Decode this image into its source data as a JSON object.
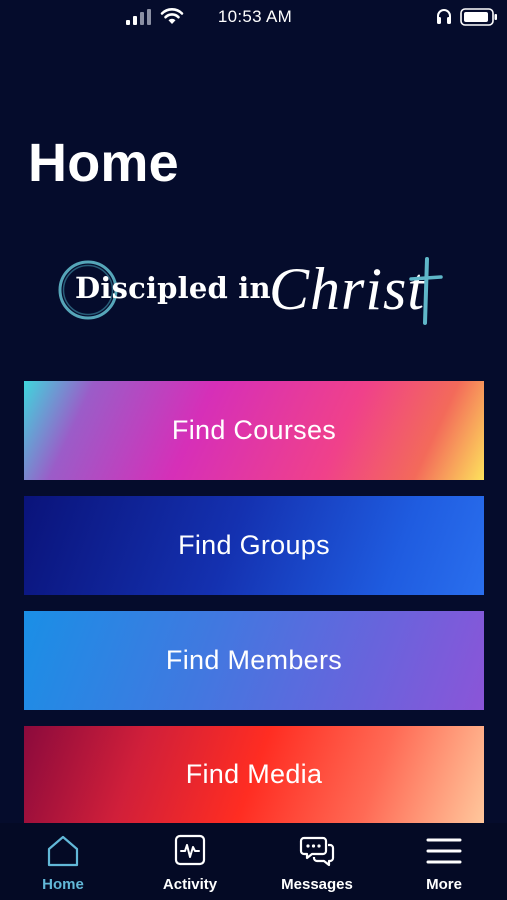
{
  "status_bar": {
    "time": "10:53 AM",
    "icons": [
      "signal-icon",
      "wifi-icon",
      "headphones-icon",
      "battery-icon"
    ]
  },
  "page": {
    "title": "Home"
  },
  "logo": {
    "word1": "Discipled in",
    "word2": "Christ"
  },
  "actions": [
    {
      "label": "Find Courses"
    },
    {
      "label": "Find Groups"
    },
    {
      "label": "Find Members"
    },
    {
      "label": "Find Media"
    }
  ],
  "tab_bar": {
    "active_tab": "Home",
    "active_color": "#62b8d8",
    "items": [
      {
        "label": "Home",
        "icon": "home-icon"
      },
      {
        "label": "Activity",
        "icon": "activity-icon"
      },
      {
        "label": "Messages",
        "icon": "messages-icon"
      },
      {
        "label": "More",
        "icon": "menu-icon"
      }
    ]
  },
  "colors": {
    "background": "#050c2c",
    "text": "#ffffff"
  }
}
